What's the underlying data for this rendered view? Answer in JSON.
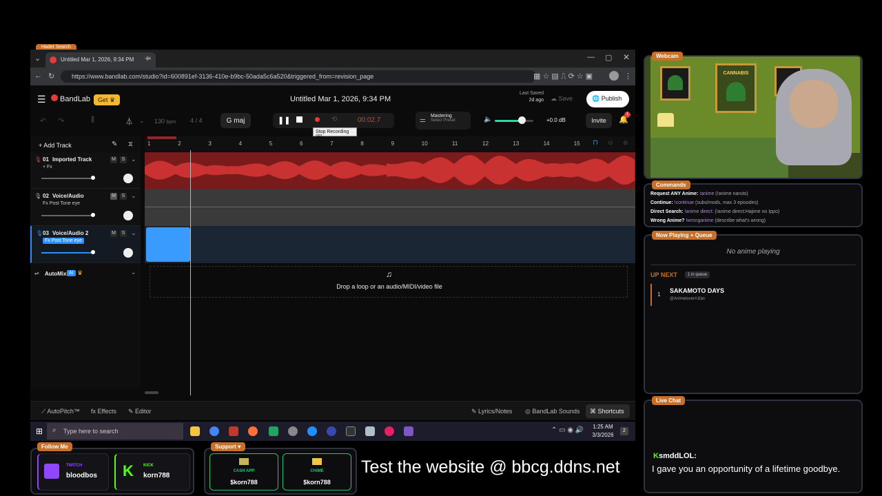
{
  "browser": {
    "tab_title": "Untitled Mar 1, 2026, 9:34 PM",
    "url": "https://www.bandlab.com/studio?id=600891ef-3136-410e-b9bc-50ada5c6a520&triggered_from=revision_page",
    "ghost_tab_label": "Hadet Search"
  },
  "bandlab": {
    "logo": "BandLab",
    "get_label": "Get",
    "project_title": "Untitled Mar 1, 2026, 9:34 PM",
    "last_saved_label": "Last Saved",
    "last_saved_value": "2d ago",
    "save_label": "Save",
    "publish_label": "Publish",
    "invite_label": "Invite",
    "notif_count": "1",
    "bpm_value": "130",
    "bpm_unit": "bpm",
    "time_sig": "4 / 4",
    "key": "G maj",
    "time": "00:02.7",
    "tooltip": "Stop Recording (R)",
    "mastering_label": "Mastering",
    "mastering_preset": "Select Preset",
    "db": "+0.0 dB",
    "add_track": "Add Track",
    "ruler_marks": [
      "1",
      "2",
      "3",
      "4",
      "5",
      "6",
      "7",
      "8",
      "9",
      "10",
      "11",
      "12",
      "13",
      "14",
      "15"
    ],
    "tracks": [
      {
        "num": "01",
        "name": "Imported Track",
        "fx": "+ Fx",
        "color": "#e53b3b"
      },
      {
        "num": "02",
        "name": "Voice/Audio",
        "fx": "Fx Post Tone eye",
        "color": "#888888"
      },
      {
        "num": "03",
        "name": "Voice/Audio 2",
        "fx": "Fx Post Tone eye",
        "color": "#2e8fff"
      }
    ],
    "m_label": "M",
    "s_label": "S",
    "automix": "AutoMix",
    "ai_badge": "AI",
    "drop_text": "Drop a loop or an audio/MIDI/video file",
    "bottom": {
      "autopitch": "AutoPitch™",
      "effects": "Effects",
      "editor": "Editor",
      "lyrics": "Lyrics/Notes",
      "sounds": "BandLab Sounds",
      "shortcuts": "Shortcuts"
    }
  },
  "taskbar": {
    "search_placeholder": "Type here to search",
    "time": "1:25 AM",
    "date": "3/3/2026",
    "notif": "2"
  },
  "overlay": {
    "webcam_tag": "Webcam",
    "poster_text": "CANNABIS",
    "commands_tag": "Commands",
    "commands": [
      {
        "label": "Request ANY Anime:",
        "cmd": "!anime",
        "hint": "(!anime naruto)"
      },
      {
        "label": "Continue:",
        "cmd": "!continue",
        "hint": "(subs/mods, max 3 episodes)"
      },
      {
        "label": "Direct Search:",
        "cmd": "!anime direct:",
        "hint": "(!anime direct:Hajime no Ippo)"
      },
      {
        "label": "Wrong Anime?",
        "cmd": "!wronganime",
        "hint": "(describe what's wrong)"
      }
    ],
    "now_playing_tag": "Now Playing + Queue",
    "no_anime": "No anime playing",
    "up_next": "UP NEXT",
    "queue_count": "1 in queue",
    "queue": [
      {
        "num": "1",
        "title": "SAKAMOTO DAYS",
        "user": "@Animelover#1fan"
      }
    ],
    "live_chat_tag": "Live Chat",
    "chat_user": "smddLOL:",
    "chat_msg": "I gave you an opportunity of a lifetime goodbye.",
    "follow_tag": "Follow Me",
    "twitch_label": "TWITCH",
    "twitch_user": "bloodbos",
    "kick_label": "KICK",
    "kick_user": "korn788",
    "support_tag": "Support",
    "cashapp_label": "CASH APP",
    "cashapp_user": "$korn788",
    "chime_label": "CHIME",
    "chime_user": "$korn788",
    "banner": "Test the website @ bbcg.ddns.net"
  },
  "colors": {
    "accent_red": "#e53b3b",
    "accent_blue": "#2e8fff",
    "orange": "#c8702a",
    "kick_green": "#53fc18",
    "twitch_purple": "#9146ff",
    "chime_green": "#1ec677"
  }
}
